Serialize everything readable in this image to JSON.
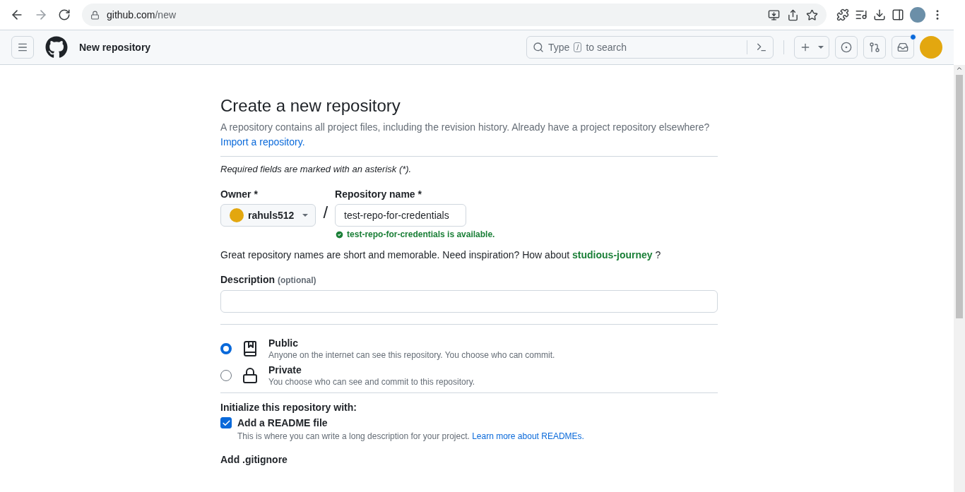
{
  "browser": {
    "url_host": "github.com",
    "url_path": "/new"
  },
  "header": {
    "title": "New repository",
    "search": {
      "before": "Type",
      "key": "/",
      "after": "to search"
    },
    "inbox_unread": true
  },
  "page": {
    "heading": "Create a new repository",
    "intro": "A repository contains all project files, including the revision history. Already have a project repository elsewhere?",
    "import_link": "Import a repository.",
    "required_note": "Required fields are marked with an asterisk (*).",
    "owner": {
      "label": "Owner *",
      "value": "rahuls512"
    },
    "separator": "/",
    "repo_name": {
      "label": "Repository name *",
      "value": "test-repo-for-credentials",
      "status": "test-repo-for-credentials is available."
    },
    "inspiration": {
      "text": "Great repository names are short and memorable. Need inspiration? How about",
      "suggestion": "studious-journey",
      "end": "?"
    },
    "description": {
      "label": "Description",
      "hint": "(optional)"
    },
    "visibility": [
      {
        "kind": "public",
        "label": "Public",
        "note": "Anyone on the internet can see this repository. You choose who can commit.",
        "selected": true
      },
      {
        "kind": "private",
        "label": "Private",
        "note": "You choose who can see and commit to this repository.",
        "selected": false
      }
    ],
    "init_heading": "Initialize this repository with:",
    "readme": {
      "label": "Add a README file",
      "note": "This is where you can write a long description for your project.",
      "link": "Learn more about READMEs.",
      "checked": true
    },
    "gitignore_label": "Add .gitignore"
  }
}
